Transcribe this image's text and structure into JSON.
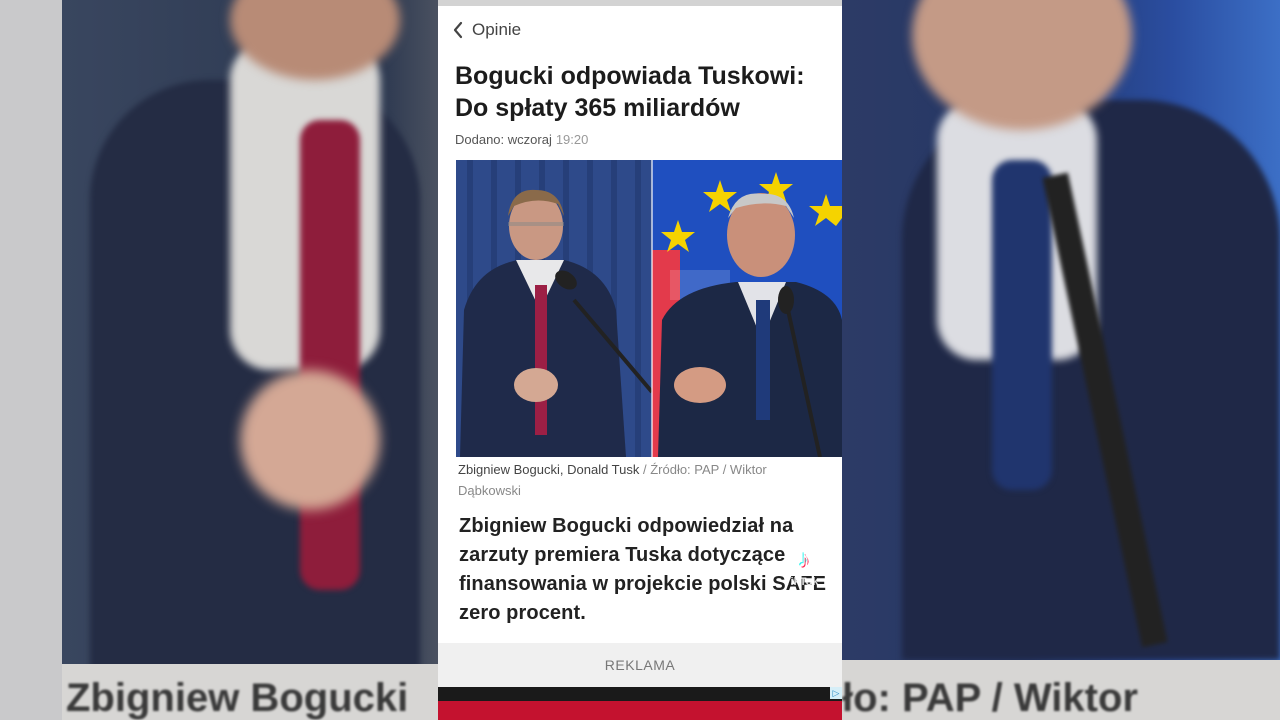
{
  "background": {
    "left_caption_fragment": "Zbigniew Bogucki",
    "right_caption_fragment": "ło: PAP / Wiktor"
  },
  "nav": {
    "back_icon": "chevron-left-icon",
    "section_label": "Opinie"
  },
  "article": {
    "headline": "Bogucki odpowiada Tuskowi: Do spłaty 365 miliardów",
    "meta_label": "Dodano: wczoraj",
    "meta_time": "19:20",
    "photo_caption_names": "Zbigniew Bogucki, Donald Tusk",
    "photo_caption_source": " / Źródło: PAP / Wiktor Dąbkowski",
    "lead": "Zbigniew Bogucki odpowiedział na zarzuty premiera Tuska dotyczące finansowania w projekcie polski SAFE zero procent."
  },
  "watermark": {
    "icon": "tiktok-icon",
    "brand": "TikTok",
    "handle": "@albatrosbojownikowolnosc"
  },
  "ad": {
    "label": "REKLAMA"
  },
  "colors": {
    "ad_red": "#c4122f",
    "eu_blue": "#1f4fbf",
    "eu_star": "#f5d300"
  }
}
